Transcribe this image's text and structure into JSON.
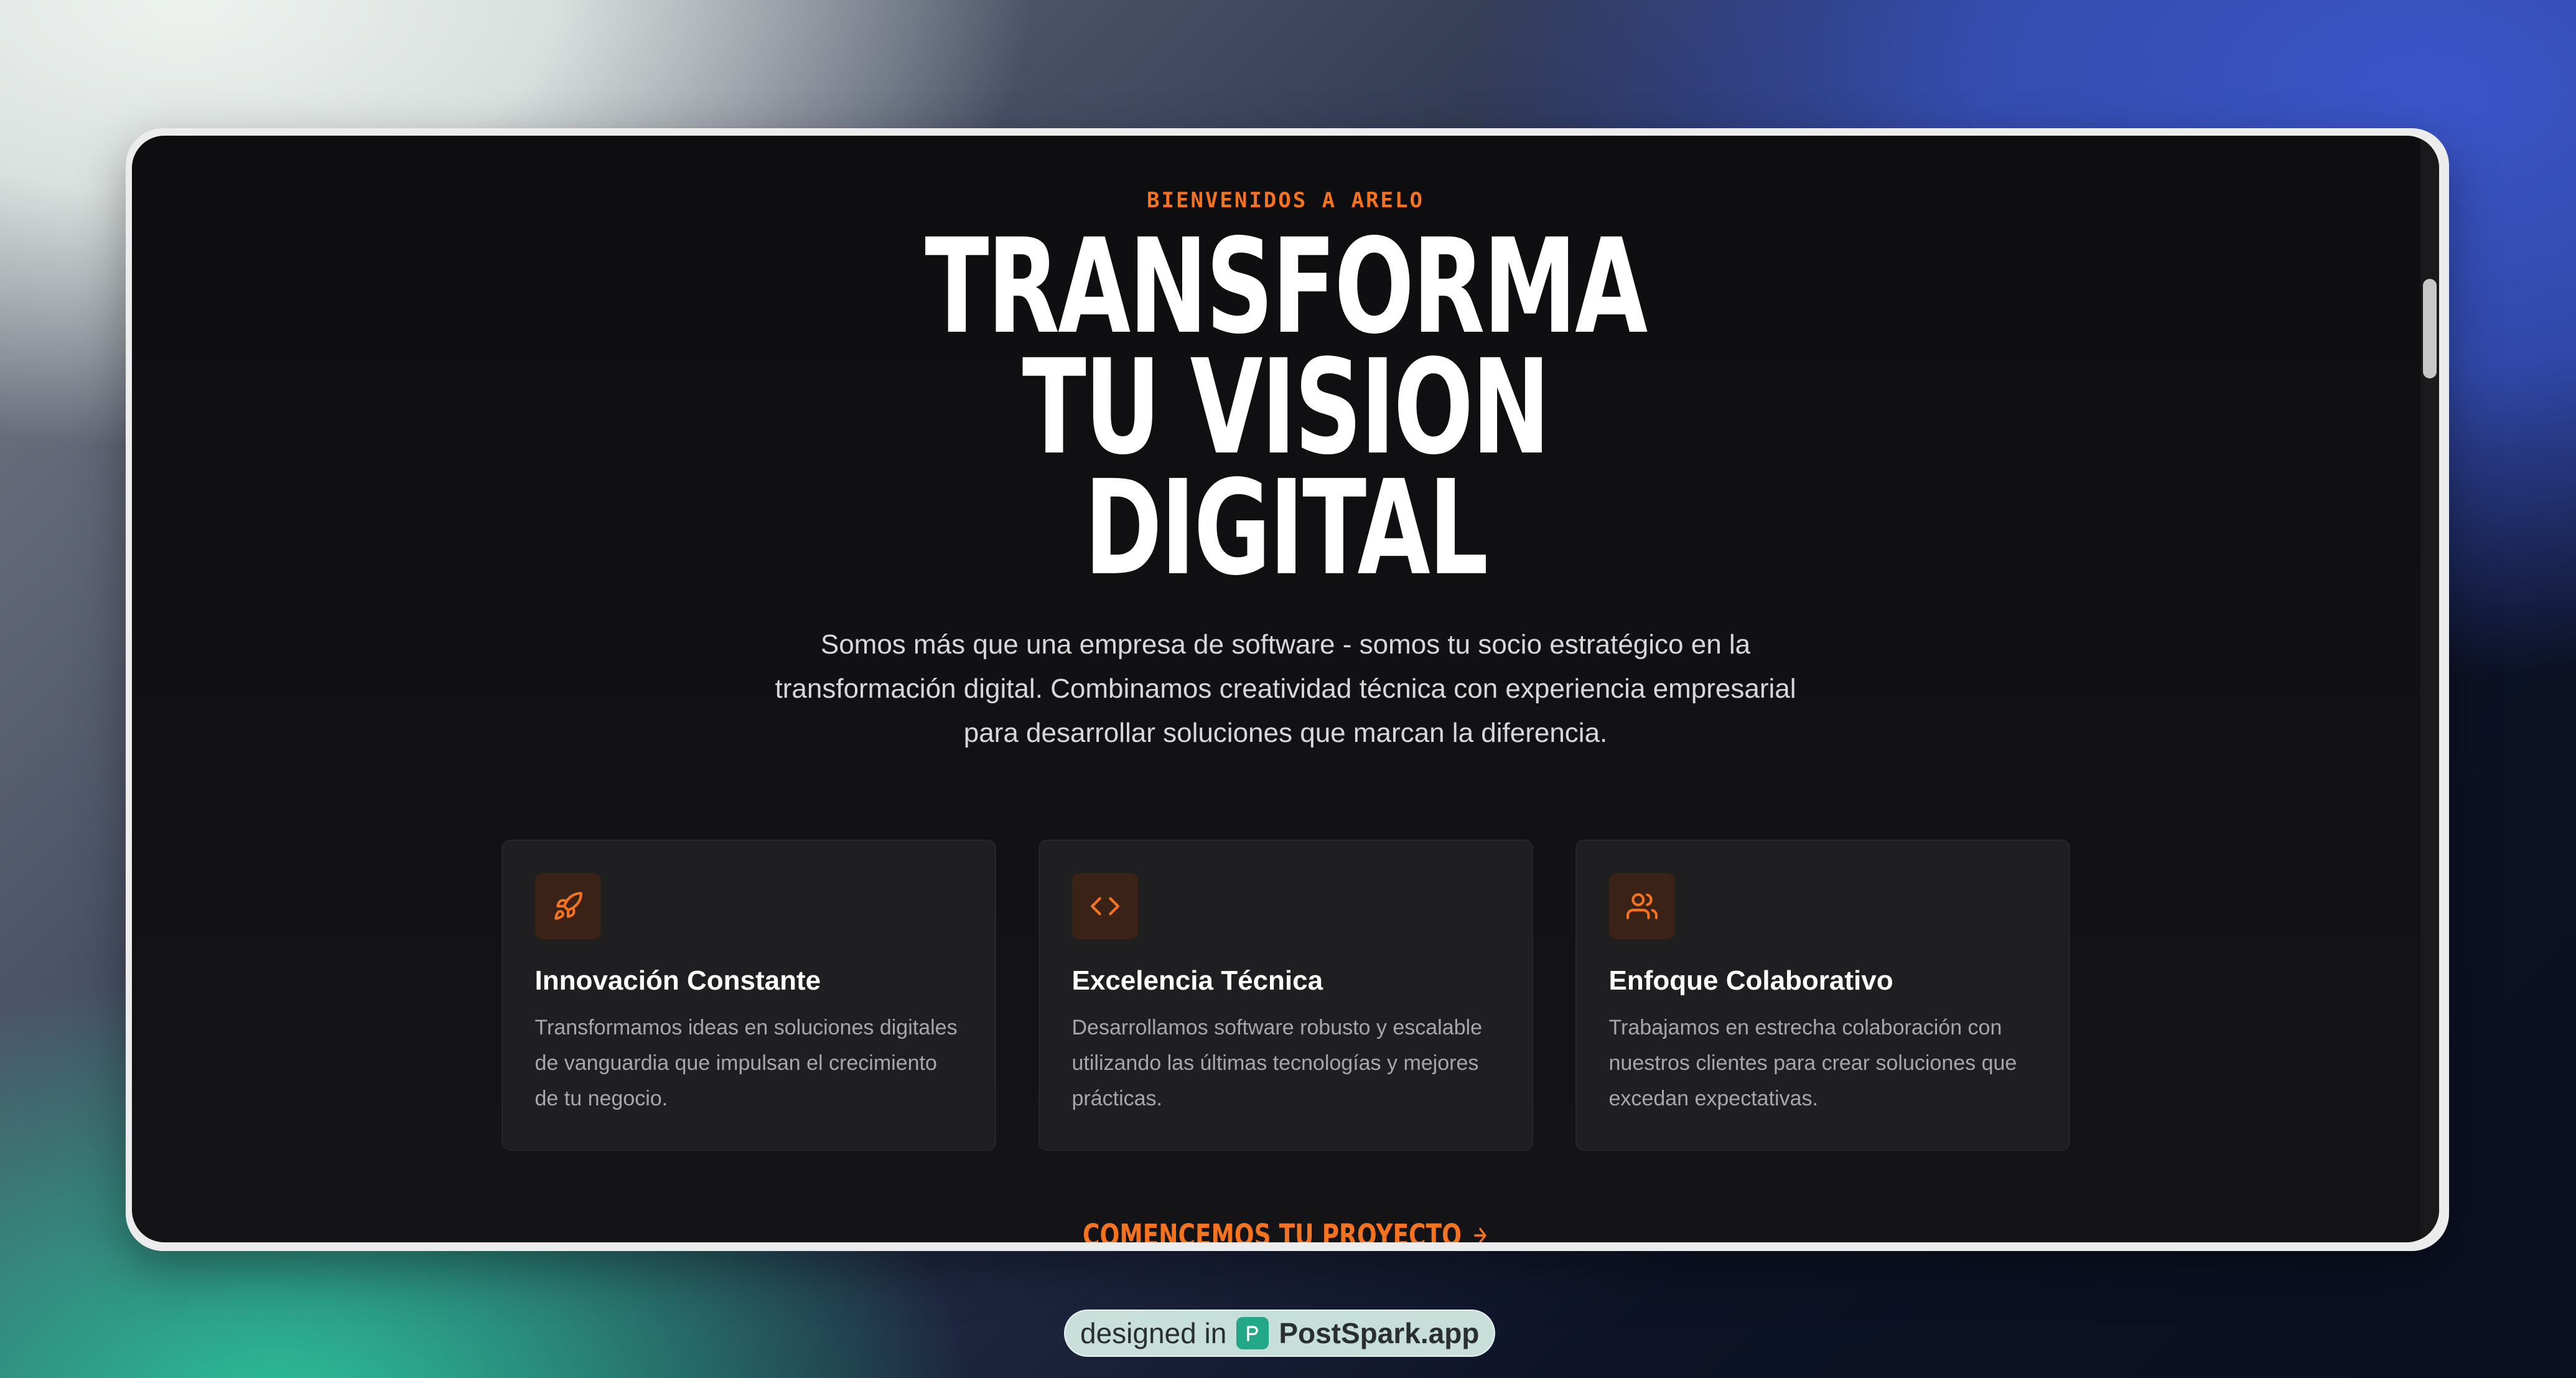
{
  "hero": {
    "eyebrow": "BIENVENIDOS A ARELO",
    "title_lines": [
      "TRANSFORMA",
      "TU VISION",
      "DIGITAL"
    ],
    "description": "Somos más que una empresa de software - somos tu socio estratégico en la transformación digital. Combinamos creatividad técnica con experiencia empresarial para desarrollar soluciones que marcan la diferencia."
  },
  "cards": [
    {
      "icon": "rocket-icon",
      "title": "Innovación Constante",
      "text": "Transformamos ideas en soluciones digitales de vanguardia que impulsan el crecimiento de tu negocio."
    },
    {
      "icon": "code-icon",
      "title": "Excelencia Técnica",
      "text": "Desarrollamos software robusto y escalable utilizando las últimas tecnologías y mejores prácticas."
    },
    {
      "icon": "users-icon",
      "title": "Enfoque Colaborativo",
      "text": "Trabajamos en estrecha colaboración con nuestros clientes para crear soluciones que excedan expectativas."
    }
  ],
  "cta": {
    "label": "COMENCEMOS TU PROYECTO",
    "icon": "arrow-right-icon"
  },
  "badge": {
    "prefix": "designed in",
    "brand": "PostSpark.app",
    "icon": "postspark-logo-icon"
  },
  "colors": {
    "accent": "#f5721e",
    "background": "#0e0e10",
    "card": "#1f1f22",
    "text": "#ffffff",
    "muted": "#a6a6ab"
  }
}
